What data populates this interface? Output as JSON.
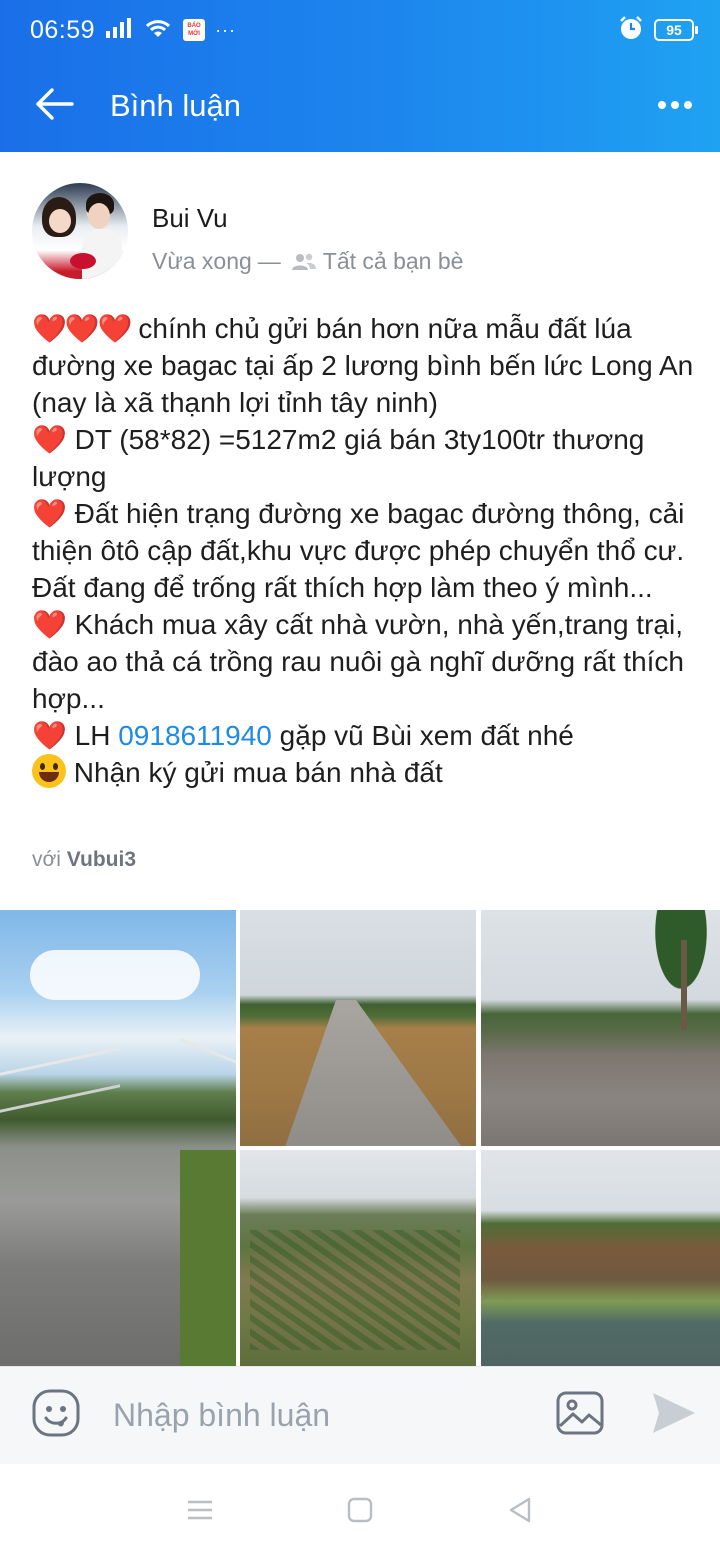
{
  "status_bar": {
    "time": "06:59",
    "app_badge": "BÁO MỚI",
    "overflow": "···",
    "battery": "95"
  },
  "app_bar": {
    "title": "Bình luận",
    "back_icon": "arrow-left-icon",
    "more_icon": "more-horizontal-icon"
  },
  "post": {
    "author": "Bui Vu",
    "time": "Vừa xong",
    "separator": "—",
    "privacy": "Tất cả bạn bè",
    "body": {
      "line1_hearts": "❤️❤️❤️",
      "line1_text": " chính chủ gửi bán hơn nữa mẫu đất lúa đường xe bagac tại ấp 2 lương bình bến lức Long An (nay là xã thạnh lợi tỉnh tây ninh)",
      "line2_text": " DT (58*82) =5127m2 giá bán 3ty100tr thương lượng",
      "line3_text": " Đất hiện trạng đường xe bagac đường thông, cải thiện ôtô cập đất,khu vực được phép chuyển thổ cư. Đất đang để trống rất thích hợp làm theo ý mình...",
      "line4_text": " Khách mua xây cất nhà vườn, nhà yến,trang trại, đào ao thả cá trồng rau nuôi gà nghĩ dưỡng rất thích hợp...",
      "line5_prefix": " LH ",
      "phone": "0918611940",
      "line5_suffix": " gặp vũ Bùi xem đất nhé",
      "line6_text": " Nhận ký gửi mua bán nhà đất",
      "heart": "❤️"
    },
    "with_prefix": "với ",
    "with_name": "Vubui3",
    "photos_count": 5
  },
  "comment_bar": {
    "placeholder": "Nhập bình luận",
    "emoji_icon": "emoji-icon",
    "image_icon": "image-icon",
    "send_icon": "send-icon"
  },
  "nav_bar": {
    "recents_icon": "menu-icon",
    "home_icon": "home-square-icon",
    "back_icon": "triangle-back-icon"
  },
  "colors": {
    "appbar_start": "#1a6fe8",
    "appbar_end": "#1fa2f2",
    "heart": "#e0202d",
    "link": "#1c8ae8",
    "muted": "#8a8f96"
  }
}
